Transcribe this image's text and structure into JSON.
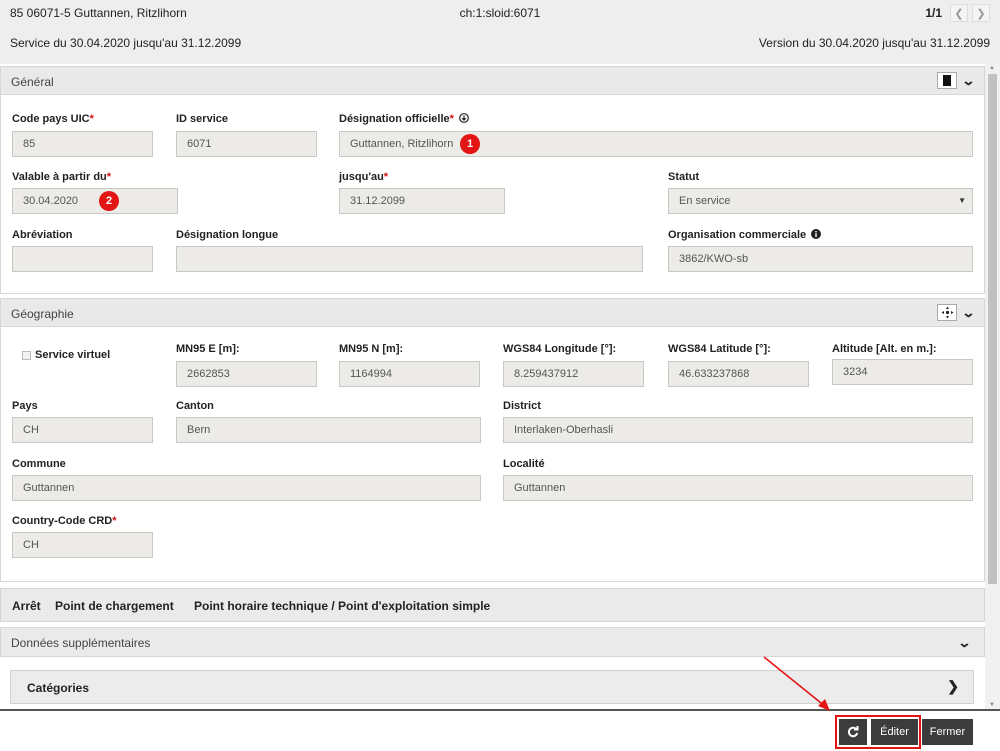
{
  "header": {
    "title": "85 06071-5 Guttannen, Ritzlihorn",
    "sloid": "ch:1:sloid:6071",
    "pager_count": "1/1",
    "service_range": "Service du 30.04.2020 jusqu'au 31.12.2099",
    "version_range": "Version du 30.04.2020 jusqu'au 31.12.2099"
  },
  "general": {
    "title": "Général",
    "code_pays_label": "Code pays UIC",
    "code_pays_value": "85",
    "id_service_label": "ID service",
    "id_service_value": "6071",
    "designation_label": "Désignation officielle",
    "designation_value": "Guttannen, Ritzlihorn",
    "valable_label": "Valable à partir du",
    "valable_value": "30.04.2020",
    "jusquau_label": "jusqu'au",
    "jusquau_value": "31.12.2099",
    "statut_label": "Statut",
    "statut_value": "En service",
    "abreviation_label": "Abréviation",
    "abreviation_value": "",
    "designation_longue_label": "Désignation longue",
    "designation_longue_value": "",
    "organisation_label": "Organisation commerciale",
    "organisation_value": "3862/KWO-sb",
    "required_mark": "*",
    "badge1": "1",
    "badge2": "2"
  },
  "geographie": {
    "title": "Géographie",
    "service_virtuel_label": "Service virtuel",
    "mn95e_label": "MN95 E [m]:",
    "mn95e_value": "2662853",
    "mn95n_label": "MN95 N [m]:",
    "mn95n_value": "1164994",
    "lon_label": "WGS84 Longitude [°]:",
    "lon_value": "8.259437912",
    "lat_label": "WGS84 Latitude [°]:",
    "lat_value": "46.633237868",
    "alt_label": "Altitude [Alt. en m.]:",
    "alt_value": "3234",
    "pays_label": "Pays",
    "pays_value": "CH",
    "canton_label": "Canton",
    "canton_value": "Bern",
    "district_label": "District",
    "district_value": "Interlaken-Oberhasli",
    "commune_label": "Commune",
    "commune_value": "Guttannen",
    "localite_label": "Localité",
    "localite_value": "Guttannen",
    "country_code_label": "Country-Code CRD",
    "country_code_value": "CH"
  },
  "tabs": {
    "arret": "Arrêt",
    "chargement": "Point de chargement",
    "horaire": "Point horaire technique / Point d'exploitation simple"
  },
  "supplementaires": {
    "title": "Données supplémentaires",
    "categories": "Catégories"
  },
  "footer": {
    "editer": "Éditer",
    "fermer": "Fermer"
  },
  "colors": {
    "badge": "#e31414",
    "button": "#3c3c3c"
  }
}
